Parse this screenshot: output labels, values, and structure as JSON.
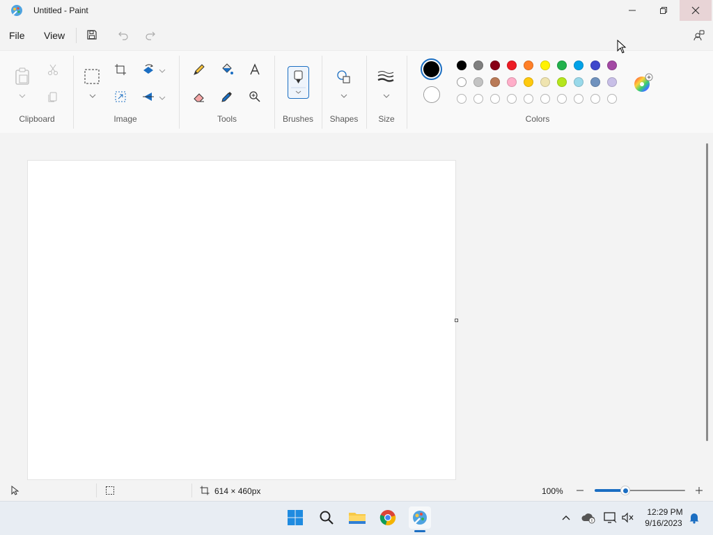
{
  "window": {
    "title": "Untitled - Paint"
  },
  "menu": {
    "file": "File",
    "view": "View"
  },
  "ribbon": {
    "groups": {
      "clipboard": "Clipboard",
      "image": "Image",
      "tools": "Tools",
      "brushes": "Brushes",
      "shapes": "Shapes",
      "size": "Size",
      "colors": "Colors"
    },
    "primary_color": "#000000",
    "secondary_color": "#ffffff",
    "palette_row1": [
      "#000000",
      "#7f7f7f",
      "#880015",
      "#ed1c24",
      "#ff7f27",
      "#fff200",
      "#22b14c",
      "#00a2e8",
      "#3f48cc",
      "#a349a4"
    ],
    "palette_row2": [
      "#ffffff",
      "#c3c3c3",
      "#b97a57",
      "#ffaec9",
      "#ffc90e",
      "#efe4b0",
      "#b5e61d",
      "#99d9ea",
      "#7092be",
      "#c8bfe7"
    ]
  },
  "status": {
    "canvas_size": "614 × 460px",
    "zoom": "100%",
    "zoom_level": 0.34
  },
  "taskbar": {
    "time": "12:29 PM",
    "date": "9/16/2023"
  }
}
